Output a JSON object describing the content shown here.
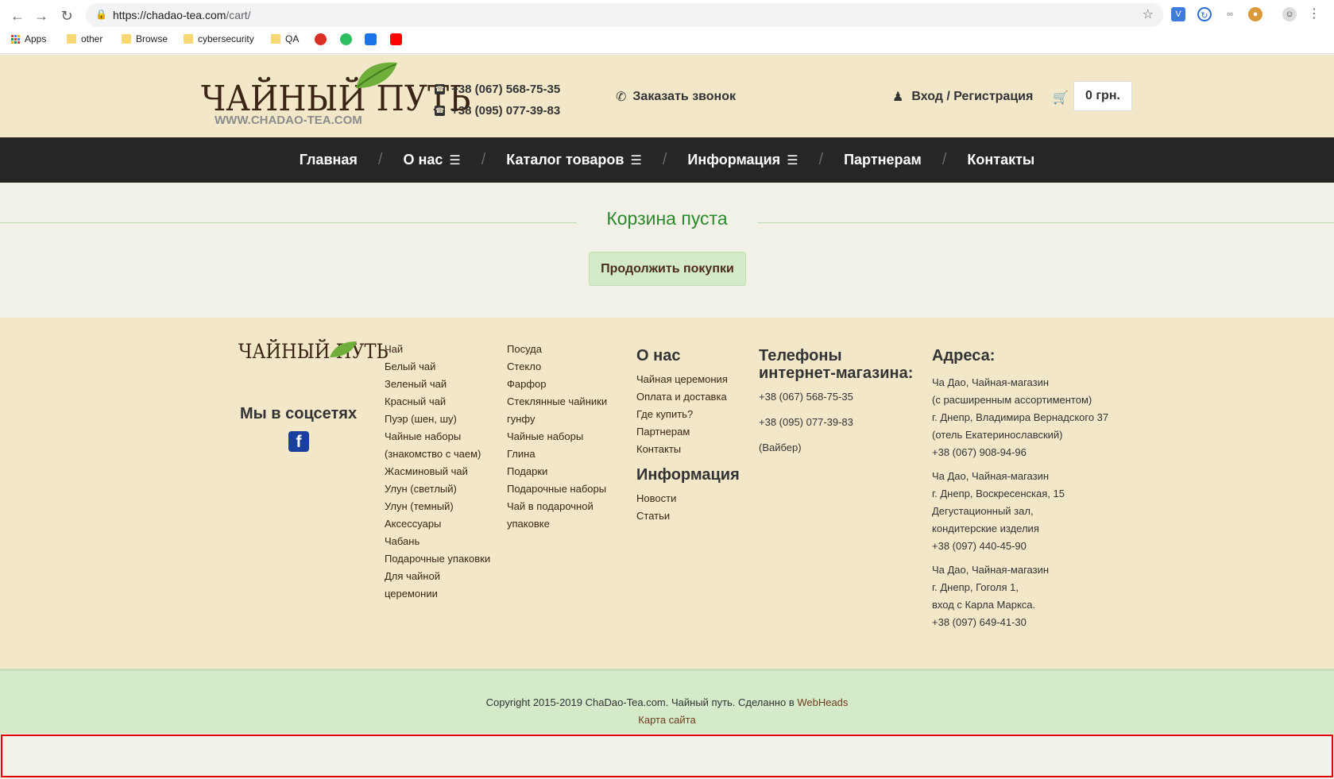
{
  "browser": {
    "url_host": "https://chadao-tea.com",
    "url_path": "/cart/",
    "bookmarks": [
      "Apps",
      "other",
      "Browse",
      "cybersecurity",
      "QA"
    ]
  },
  "header": {
    "logo_text": "ЧАЙНЫЙ ПУТЬ",
    "logo_url": "WWW.CHADAO-TEA.COM",
    "phone1": "+38 (067) 568-75-35",
    "phone2": "+38 (095) 077-39-83",
    "callback": "Заказать звонок",
    "login": "Вход / Регистрация",
    "cart_total": "0 грн."
  },
  "nav": {
    "items": [
      {
        "label": "Главная",
        "menu": false
      },
      {
        "label": "О нас",
        "menu": true
      },
      {
        "label": "Каталог товаров",
        "menu": true
      },
      {
        "label": "Информация",
        "menu": true
      },
      {
        "label": "Партнерам",
        "menu": false
      },
      {
        "label": "Контакты",
        "menu": false
      }
    ]
  },
  "cart": {
    "title": "Корзина пуста",
    "continue_label": "Продолжить покупки"
  },
  "footer": {
    "logo_text": "ЧАЙНЫЙ ПУТЬ",
    "social_title": "Мы в соцсетях",
    "col1": [
      "Чай",
      "Белый чай",
      "Зеленый чай",
      "Красный чай",
      "Пуэр (шен, шу)",
      "Чайные наборы",
      "(знакомство с чаем)",
      "Жасминовый чай",
      "Улун (светлый)",
      "Улун (темный)",
      "Аксессуары",
      "Чабань",
      "Подарочные упаковки",
      "Для чайной",
      "церемонии"
    ],
    "col2": [
      "Посуда",
      "Стекло",
      "Фарфор",
      "Стеклянные чайники",
      "гунфу",
      "Чайные наборы",
      "Глина",
      "Подарки",
      "Подарочные наборы",
      "Чай в подарочной",
      "упаковке"
    ],
    "about_title": "О нас",
    "about_links": [
      "Чайная церемония",
      "Оплата и доставка",
      "Где купить?",
      "Партнерам",
      "Контакты"
    ],
    "info_title": "Информация",
    "info_links": [
      "Новости",
      "Статьи"
    ],
    "phones_title_1": "Телефоны",
    "phones_title_2": "интернет-магазина:",
    "phone1": "+38 (067) 568-75-35",
    "phone2": "+38 (095) 077-39-83",
    "viber": "(Вайбер)",
    "addr_title": "Адреса:",
    "addr1": [
      "Ча Дао, Чайная-магазин",
      "(с расширенным ассортиментом)",
      "г. Днепр, Владимира Вернадского 37",
      "(отель Екатеринославский)",
      "+38 (067) 908-94-96"
    ],
    "addr2": [
      "Ча Дао, Чайная-магазин",
      "г. Днепр, Воскресенская, 15",
      "Дегустационный зал,",
      "кондитерские изделия",
      "+38 (097) 440-45-90"
    ],
    "addr3": [
      "Ча Дао, Чайная-магазин",
      "г. Днепр, Гоголя 1,",
      "вход с Карла Маркса.",
      "+38 (097) 649-41-30"
    ]
  },
  "copyright": {
    "text": "Copyright 2015-2019 ChaDao-Tea.com. Чайный путь. Сделанно в ",
    "webheads": "WebHeads",
    "sitemap": "Карта сайта"
  }
}
